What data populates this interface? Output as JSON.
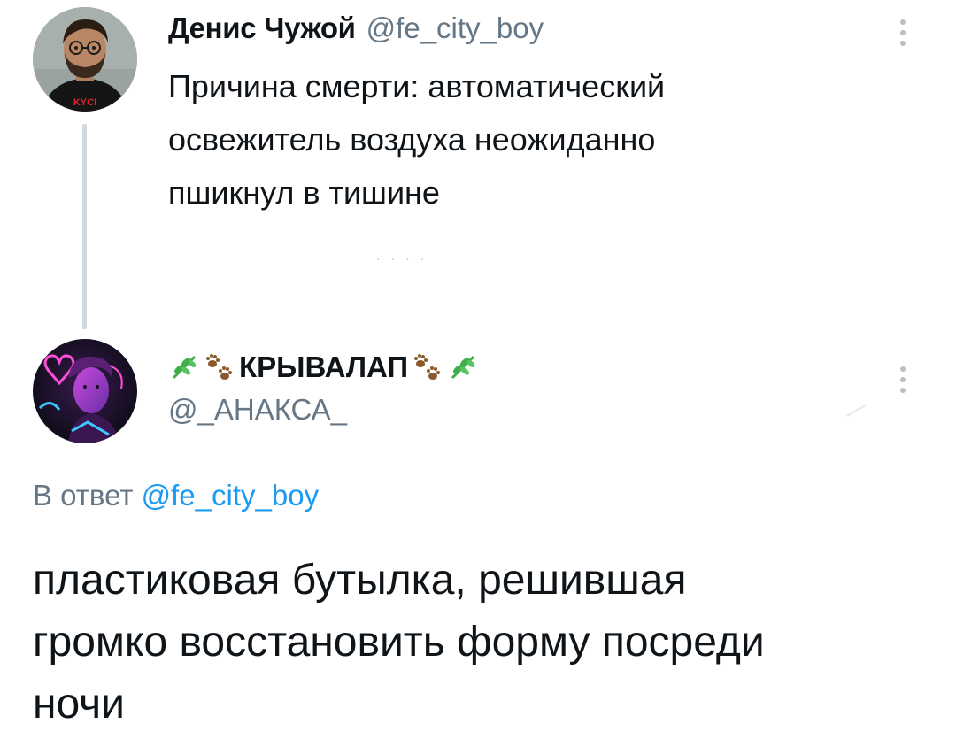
{
  "tweet1": {
    "author_name": "Денис Чужой",
    "author_handle": "@fe_city_boy",
    "avatar_icon": "avatar-man-icon",
    "avatar_shirt_text": "KYCI",
    "text": "Причина смерти: автоматический\nосвежитель воздуха неожиданно\nпшикнул в тишине",
    "more_icon": "more-vertical-icon"
  },
  "tweet2": {
    "author_name": "КРЫВАЛАП",
    "author_handle": "@_АНАКСА_",
    "avatar_icon": "avatar-neon-portrait-icon",
    "name_emojis": [
      "herb-icon",
      "paw-prints-icon",
      "paw-prints-icon",
      "herb-icon"
    ],
    "reply_prefix": "В ответ",
    "reply_handle": "@fe_city_boy",
    "text": "пластиковая бутылка, решившая\nгромко восстановить форму посреди\nночи",
    "more_icon": "more-vertical-icon"
  },
  "colors": {
    "text_primary": "#0f1419",
    "text_secondary": "#657786",
    "link": "#1d9bf0",
    "thread_line": "#cfd9de",
    "herb_green": "#3fae49",
    "paw_brown": "#8b5a2b"
  }
}
